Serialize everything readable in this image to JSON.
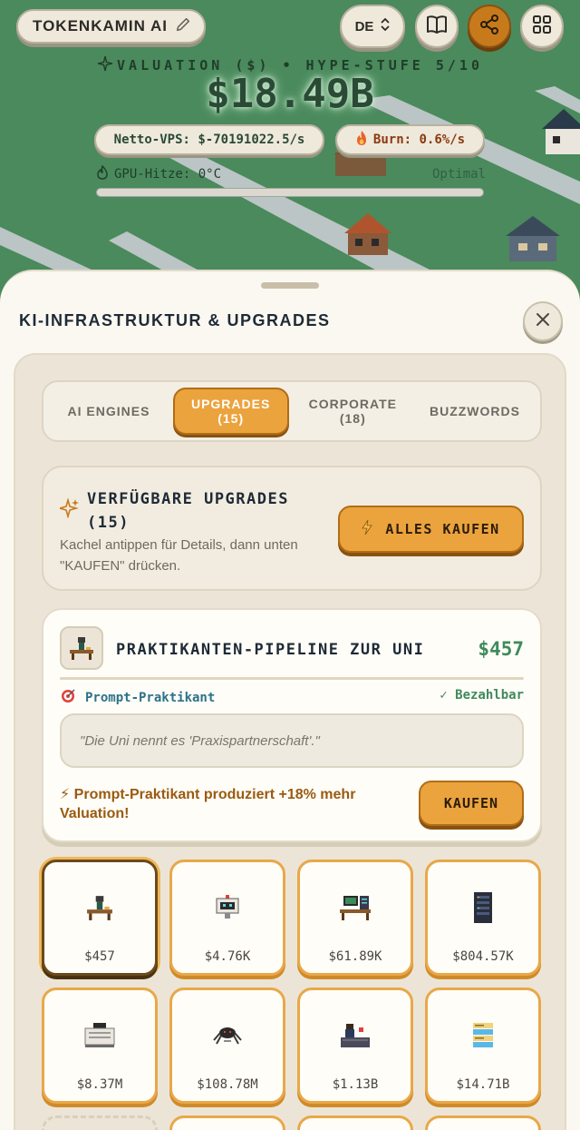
{
  "hud": {
    "company_name": "TOKENKAMIN AI",
    "language": "DE",
    "valuation_caption": "VALUATION ($) • HYPE-STUFE 5/10",
    "valuation_amount": "$18.49B",
    "net_vps": "Netto-VPS: $-70191022.5/s",
    "burn": "Burn: 0.6%/s",
    "gpu_label": "GPU-Hitze: 0°C",
    "gpu_status": "Optimal",
    "gpu_heat_fraction": 0.0,
    "icons": [
      "edit-icon",
      "book-icon",
      "share-icon",
      "grid-icon",
      "sparkle-icon",
      "fire-icon",
      "flame-icon"
    ]
  },
  "sheet": {
    "title": "KI-INFRASTRUKTUR & UPGRADES",
    "tabs": [
      {
        "label": "AI ENGINES",
        "count": ""
      },
      {
        "label": "UPGRADES",
        "count": "(15)"
      },
      {
        "label": "CORPORATE",
        "count": "(18)"
      },
      {
        "label": "BUZZWORDS",
        "count": ""
      }
    ],
    "active_tab": 1,
    "info": {
      "title": "VERFÜGBARE UPGRADES (15)",
      "description": "Kachel antippen für Details, dann unten \"KAUFEN\" drücken.",
      "buy_all_label": "ALLES KAUFEN"
    },
    "detail": {
      "name": "PRAKTIKANTEN-PIPELINE ZUR UNI",
      "price": "$457",
      "requirement": "Prompt-Praktikant",
      "status": "✓ Bezahlbar",
      "quote": "\"Die Uni nennt es 'Praxispartnerschaft'.\"",
      "effect": "⚡ Prompt-Praktikant produziert +18% mehr Valuation!",
      "buy_label": "KAUFEN"
    },
    "tiles": [
      {
        "price": "$457",
        "icon": "intern-desk-icon"
      },
      {
        "price": "$4.76K",
        "icon": "robot-screen-icon"
      },
      {
        "price": "$61.89K",
        "icon": "server-desk-icon"
      },
      {
        "price": "$804.57K",
        "icon": "server-rack-icon"
      },
      {
        "price": "$8.37M",
        "icon": "printer-icon"
      },
      {
        "price": "$108.78M",
        "icon": "spider-bot-icon"
      },
      {
        "price": "$1.13B",
        "icon": "ceo-desk-icon"
      },
      {
        "price": "$14.71B",
        "icon": "data-stack-icon"
      }
    ]
  },
  "colors": {
    "accent": "#eba33e",
    "grass": "#4a8a5c",
    "money_green": "#3f8a5c",
    "link_blue": "#2c7289"
  }
}
